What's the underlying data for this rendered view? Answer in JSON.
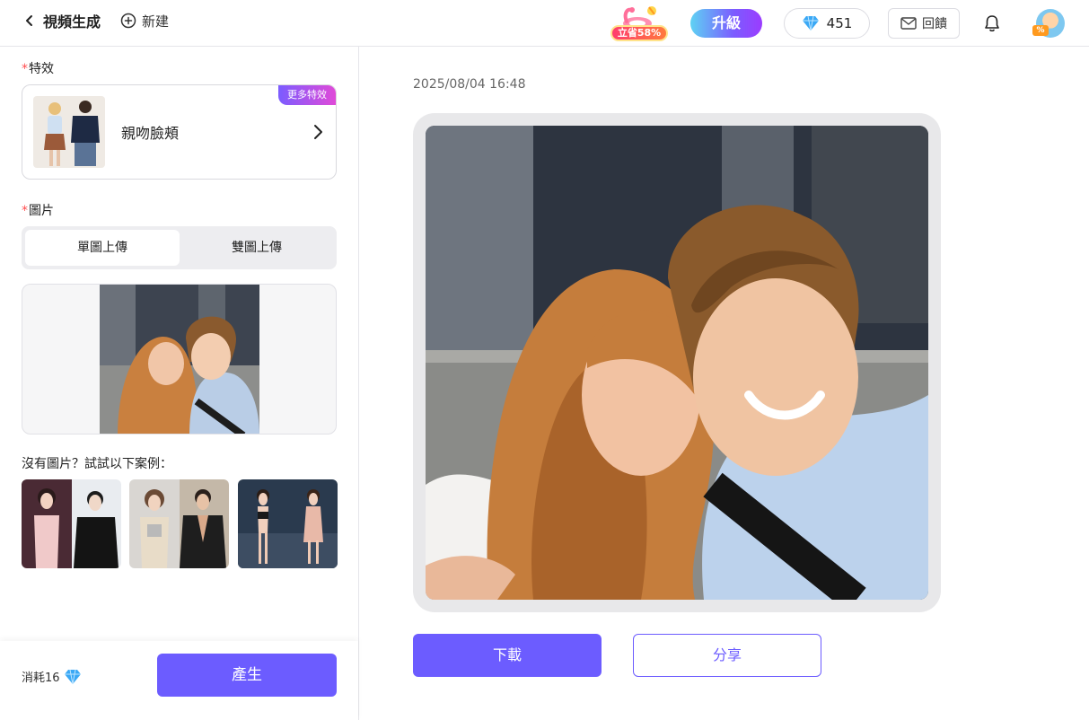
{
  "header": {
    "title": "視頻生成",
    "new_label": "新建",
    "promo_badge": "立省58%",
    "upgrade_label": "升級",
    "credits": "451",
    "feedback_label": "回饋",
    "avatar_tag": "%"
  },
  "left": {
    "effect_section_label": "特效",
    "effect_name": "親吻臉頰",
    "more_effects_label": "更多特效",
    "image_section_label": "圖片",
    "tabs": [
      {
        "label": "單圖上傳",
        "active": true
      },
      {
        "label": "雙圖上傳",
        "active": false
      }
    ],
    "examples_label": "沒有圖片？試試以下案例："
  },
  "footer": {
    "cost_label": "消耗16",
    "generate_label": "產生"
  },
  "result": {
    "timestamp": "2025/08/04 16:48",
    "download_label": "下載",
    "share_label": "分享"
  },
  "colors": {
    "accent": "#6c5cff",
    "required": "#ff4d4f",
    "diamond": "#3aa8f5"
  }
}
